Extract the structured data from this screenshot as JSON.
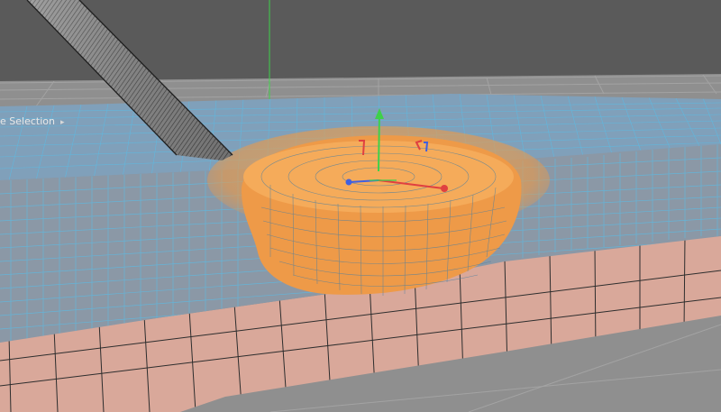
{
  "viewport": {
    "selection_label": "e Selection",
    "selection_arrow": "▸"
  },
  "gizmo": {
    "axes": [
      {
        "name": "y-axis",
        "color": "#3fd04a"
      },
      {
        "name": "x-axis",
        "color": "#e04040"
      },
      {
        "name": "z-axis",
        "color": "#4060e0"
      }
    ]
  },
  "colors": {
    "background": "#5b5b5b",
    "ground": "#8f8f8f",
    "mesh_top": "#7f9fb9",
    "mesh_front": "#8a97a5",
    "wireframe": "#5fb9e0",
    "soft_selection": "#f0a050",
    "base_block": "#d9a89a",
    "tool_shaft": "#9a9a9a"
  }
}
